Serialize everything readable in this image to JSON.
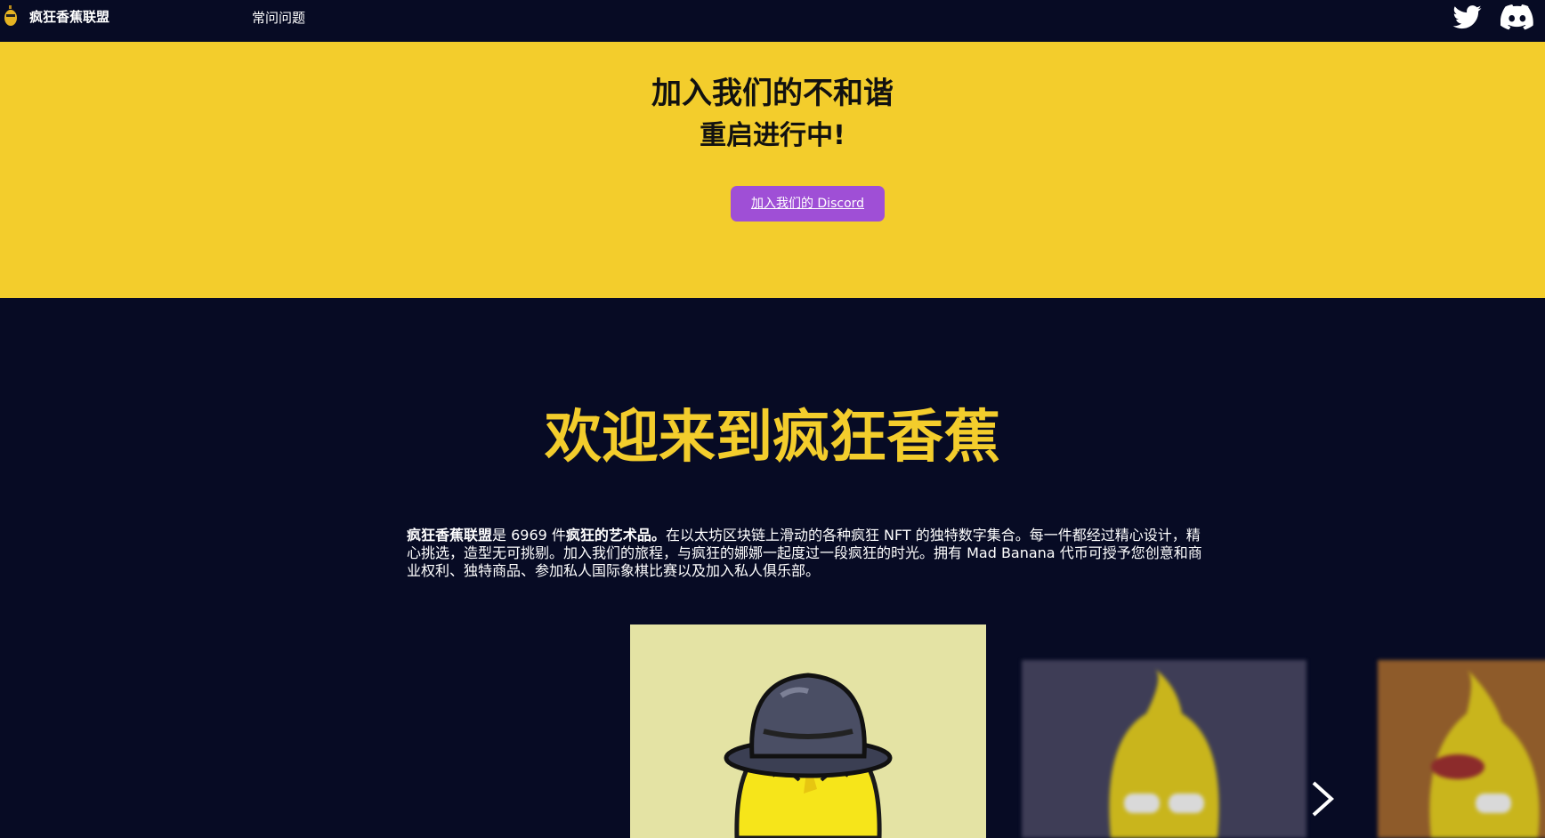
{
  "nav": {
    "brand": "疯狂香蕉联盟",
    "faq": "常问问题",
    "icons": [
      "banana-logo-icon",
      "twitter-icon",
      "discord-icon"
    ]
  },
  "banner": {
    "title": "加入我们的不和谐",
    "subtitle": "重启进行中!",
    "button_label": "加入我们的 Discord"
  },
  "welcome": {
    "title": "欢迎来到疯狂香蕉",
    "intro_brand": "疯狂香蕉联盟",
    "intro_part1": "是 6969 件",
    "intro_bold2": "疯狂的艺术品。",
    "intro_part2": "在以太坊区块链上滑动的各种疯狂 NFT 的独特数字集合。每一件都经过精心设计，精心挑选，造型无可挑剔。加入我们的旅程，与疯狂的娜娜一起度过一段疯狂的时光。拥有 Mad Banana 代币可授予您创意和商业权利、独特商品、参加私人国际象棋比赛以及加入私人俱乐部。"
  },
  "gallery": {
    "cards": [
      "banana-bowler-hat",
      "banana-sunglasses",
      "banana-red-scarf"
    ],
    "next_icon": "chevron-right-icon"
  },
  "colors": {
    "background": "#070b24",
    "banner": "#f3cd2c",
    "accent_title": "#f3cd2c",
    "button": "#9f4fd6"
  }
}
